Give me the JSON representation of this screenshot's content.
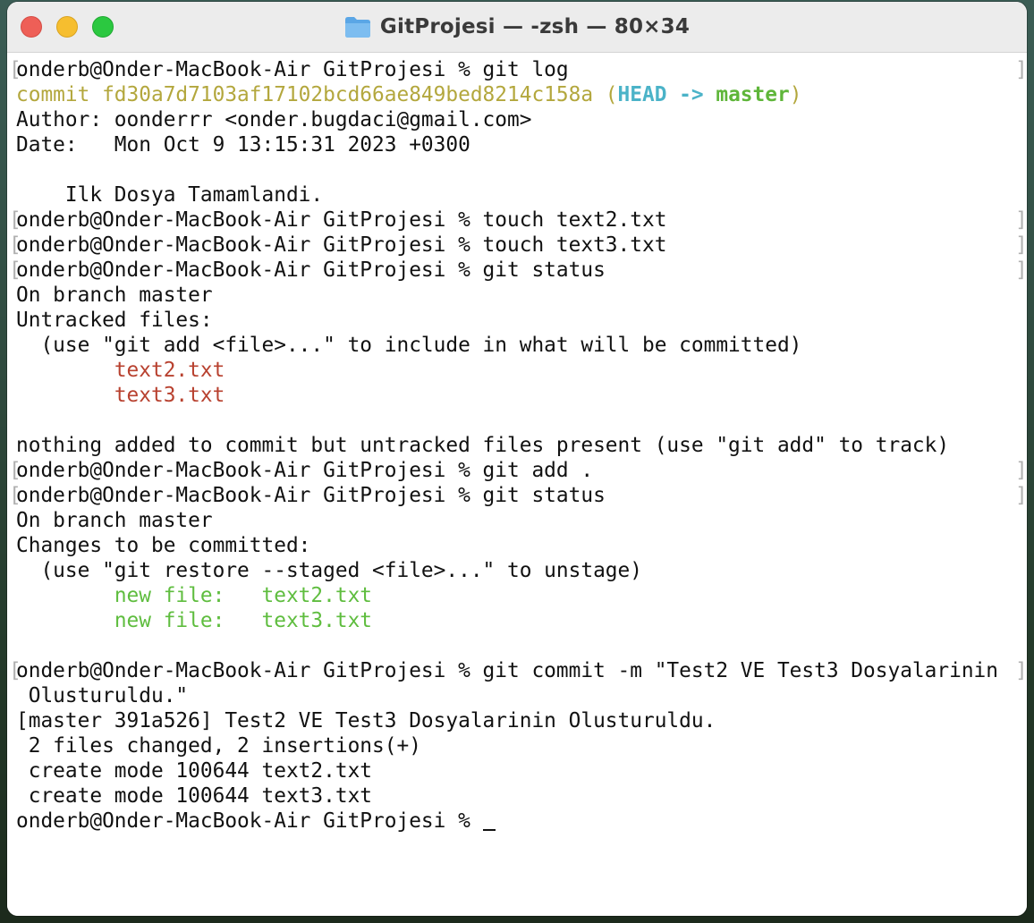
{
  "window": {
    "title": "GitProjesi — -zsh — 80×34",
    "folder_icon": "folder-icon"
  },
  "terminal": {
    "lines": [
      {
        "text": "onderb@Onder-MacBook-Air GitProjesi % git log"
      },
      {
        "commit_label": "commit fd30a7d7103af17102bcd66ae849bed8214c158a",
        "open_paren": " (",
        "head": "HEAD -> ",
        "branch": "master",
        "close_paren": ")"
      },
      {
        "text": "Author: oonderrr <onder.bugdaci@gmail.com>"
      },
      {
        "text": "Date:   Mon Oct 9 13:15:31 2023 +0300"
      },
      {
        "text": ""
      },
      {
        "text": "    Ilk Dosya Tamamlandi."
      },
      {
        "text": "onderb@Onder-MacBook-Air GitProjesi % touch text2.txt"
      },
      {
        "text": "onderb@Onder-MacBook-Air GitProjesi % touch text3.txt"
      },
      {
        "text": "onderb@Onder-MacBook-Air GitProjesi % git status"
      },
      {
        "text": "On branch master"
      },
      {
        "text": "Untracked files:"
      },
      {
        "text": "  (use \"git add <file>...\" to include in what will be committed)"
      },
      {
        "indent": "        ",
        "text": "text2.txt"
      },
      {
        "indent": "        ",
        "text": "text3.txt"
      },
      {
        "text": ""
      },
      {
        "text": "nothing added to commit but untracked files present (use \"git add\" to track)"
      },
      {
        "text": "onderb@Onder-MacBook-Air GitProjesi % git add ."
      },
      {
        "text": "onderb@Onder-MacBook-Air GitProjesi % git status"
      },
      {
        "text": "On branch master"
      },
      {
        "text": "Changes to be committed:"
      },
      {
        "text": "  (use \"git restore --staged <file>...\" to unstage)"
      },
      {
        "indent": "        ",
        "text": "new file:   text2.txt"
      },
      {
        "indent": "        ",
        "text": "new file:   text3.txt"
      },
      {
        "text": ""
      },
      {
        "text": "onderb@Onder-MacBook-Air GitProjesi % git commit -m \"Test2 VE Test3 Dosyalarinin"
      },
      {
        "text": " Olusturuldu.\""
      },
      {
        "text": "[master 391a526] Test2 VE Test3 Dosyalarinin Olusturuldu."
      },
      {
        "text": " 2 files changed, 2 insertions(+)"
      },
      {
        "text": " create mode 100644 text2.txt"
      },
      {
        "text": " create mode 100644 text3.txt"
      },
      {
        "prompt": "onderb@Onder-MacBook-Air GitProjesi % "
      }
    ],
    "bracket_left": "[",
    "bracket_right": "]"
  },
  "colors": {
    "commit_hash": "#b3a73d",
    "head_ref": "#4bb3c8",
    "branch_ref": "#5fb63a",
    "untracked_file": "#b8412f",
    "staged_file": "#5fbd3f"
  }
}
